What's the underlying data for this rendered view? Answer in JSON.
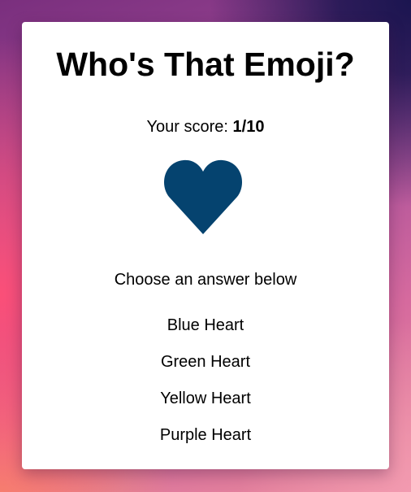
{
  "title": "Who's That Emoji?",
  "score": {
    "label": "Your score: ",
    "value": "1/10"
  },
  "emoji": {
    "icon": "blue-heart-icon",
    "color": "#05436f"
  },
  "prompt": "Choose an answer below",
  "answers": [
    {
      "label": "Blue Heart"
    },
    {
      "label": "Green Heart"
    },
    {
      "label": "Yellow Heart"
    },
    {
      "label": "Purple Heart"
    }
  ]
}
